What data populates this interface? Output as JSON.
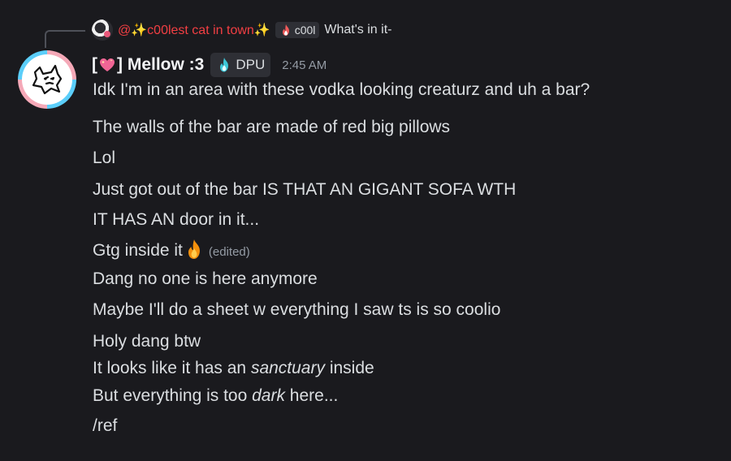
{
  "reply": {
    "mention": "@✨c00lest cat in town✨",
    "tag_label": "c00l",
    "preview": "What's in it-"
  },
  "author": {
    "name_prefix": "[",
    "name_suffix": "] Mellow :3",
    "badge_label": "DPU",
    "timestamp": "2:45 AM"
  },
  "messages": [
    {
      "text": "Idk I'm in an area with these vodka looking creaturz and uh a bar?"
    },
    {
      "text": "The walls of the bar are made of red big pillows"
    },
    {
      "text": "Lol"
    },
    {
      "text": "Just got out of the bar IS THAT AN GIGANT SOFA WTH"
    },
    {
      "text": "IT HAS AN door in it..."
    },
    {
      "text": "Gtg inside it",
      "edited": "(edited)"
    },
    {
      "text": "Dang no one is here anymore"
    },
    {
      "text": "Maybe I'll do a sheet w everything I saw ts is so coolio"
    },
    {
      "text": "Holy dang btw"
    },
    {
      "pre": "It looks like it has an ",
      "em": "sanctuary",
      "post": " inside"
    },
    {
      "pre": "But everything is too ",
      "em": "dark",
      "post": " here..."
    },
    {
      "text": "/ref"
    }
  ],
  "colors": {
    "background": "#1a1a1e",
    "mention": "#f23f43",
    "text": "#dbdee1",
    "muted": "#949ba4"
  },
  "icons": {
    "reply_tag": "fire-icon",
    "badge": "blue-fire-icon",
    "name": "sparkling-heart-icon",
    "emoji": "fire-emoji"
  }
}
